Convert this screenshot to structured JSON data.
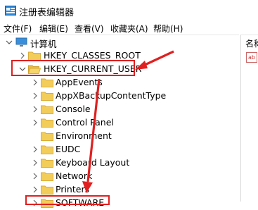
{
  "window": {
    "title": "注册表编辑器"
  },
  "menu": [
    "文件(F)",
    "编辑(E)",
    "查看(V)",
    "收藏夹(A)",
    "帮助(H)"
  ],
  "tree": {
    "root": "计算机",
    "items": [
      {
        "label": "HKEY_CLASSES_ROOT",
        "expanded": false
      },
      {
        "label": "HKEY_CURRENT_USER",
        "expanded": true,
        "children": [
          "AppEvents",
          "AppXBackupContentType",
          "Console",
          "Control Panel",
          "Environment",
          "EUDC",
          "Keyboard Layout",
          "Network",
          "Printers",
          "SOFTWARE"
        ]
      }
    ]
  },
  "right_pane": {
    "header": "名称"
  },
  "colors": {
    "highlight": "#e02020",
    "folder": "#f3cd5a"
  }
}
